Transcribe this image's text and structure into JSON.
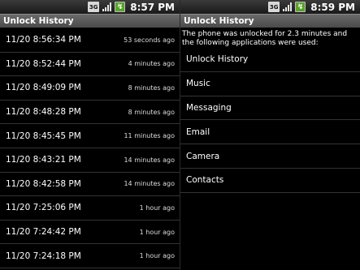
{
  "left": {
    "status": {
      "network": "3G",
      "time": "8:57 PM"
    },
    "title": "Unlock History",
    "history": [
      {
        "time": "11/20 8:56:34 PM",
        "ago": "53 seconds ago"
      },
      {
        "time": "11/20 8:52:44 PM",
        "ago": "4 minutes ago"
      },
      {
        "time": "11/20 8:49:09 PM",
        "ago": "8 minutes ago"
      },
      {
        "time": "11/20 8:48:28 PM",
        "ago": "8 minutes ago"
      },
      {
        "time": "11/20 8:45:45 PM",
        "ago": "11 minutes ago"
      },
      {
        "time": "11/20 8:43:21 PM",
        "ago": "14 minutes ago"
      },
      {
        "time": "11/20 8:42:58 PM",
        "ago": "14 minutes ago"
      },
      {
        "time": "11/20 7:25:06 PM",
        "ago": "1 hour ago"
      },
      {
        "time": "11/20 7:24:42 PM",
        "ago": "1 hour ago"
      },
      {
        "time": "11/20 7:24:18 PM",
        "ago": "1 hour ago"
      }
    ]
  },
  "right": {
    "status": {
      "network": "3G",
      "time": "8:59 PM"
    },
    "title": "Unlock History",
    "description": "The phone was unlocked for 2.3 minutes and the following applications were used:",
    "apps": [
      "Unlock History",
      "Music",
      "Messaging",
      "Email",
      "Camera",
      "Contacts"
    ]
  },
  "icons": {
    "network": "3g-icon",
    "signal": "signal-strength-icon",
    "battery": "battery-charging-icon"
  }
}
